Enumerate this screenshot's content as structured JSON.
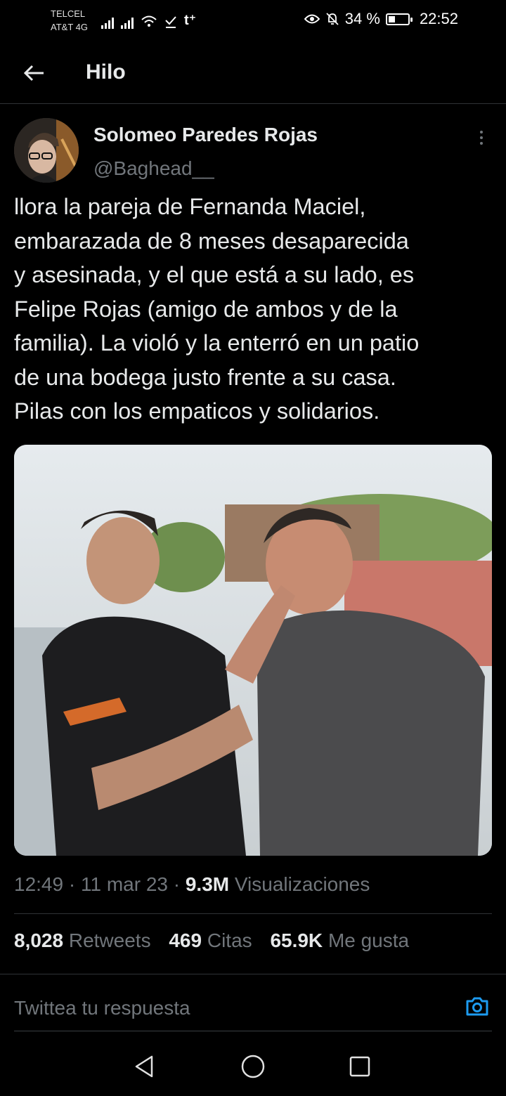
{
  "status_bar": {
    "carrier_1": "TELCEL",
    "carrier_2": "AT&T 4G",
    "battery_percent": "34 %",
    "battery_level": 0.34,
    "time": "22:52"
  },
  "header": {
    "title": "Hilo",
    "back_icon": "arrow-left-icon"
  },
  "tweet": {
    "display_name": "Solomeo Paredes Rojas",
    "handle": "@Baghead__",
    "text": "llora  la pareja de Fernanda Maciel,\nembarazada de 8 meses desaparecida\ny asesinada, y el  que está a su lado, es\nFelipe Rojas (amigo de ambos y de la\nfamilia). La violó y la enterró en un patio\nde una bodega justo frente a su casa.\nPilas con los empaticos y solidarios.",
    "time": "12:49",
    "date": "11 mar 23",
    "views_count": "9.3M",
    "views_label": "Visualizaciones",
    "retweets_count": "8,028",
    "retweets_label": "Retweets",
    "quotes_count": "469",
    "quotes_label": "Citas",
    "likes_count": "65.9K",
    "likes_label": "Me gusta"
  },
  "reply": {
    "placeholder": "Twittea tu respuesta",
    "camera_icon": "camera-icon"
  },
  "nav": {
    "back": "triangle-back-icon",
    "home": "circle-home-icon",
    "recents": "square-recents-icon"
  },
  "colors": {
    "background": "#000000",
    "text_primary": "#e7e9ea",
    "text_secondary": "#71767b",
    "accent": "#1d9bf0",
    "divider": "#2f3336"
  }
}
